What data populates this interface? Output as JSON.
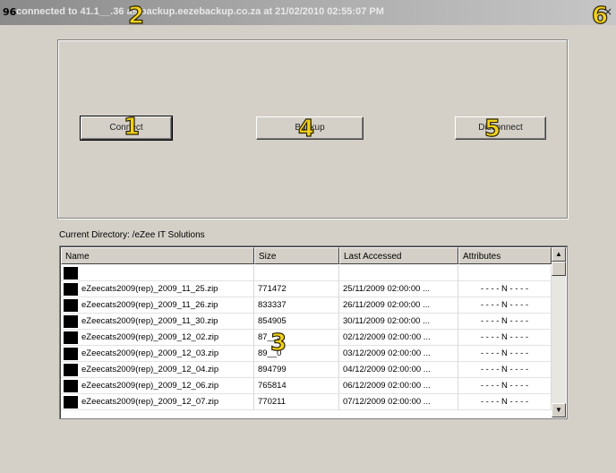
{
  "window": {
    "title": "connected to 41.1__.36 as backup.eezebackup.co.za at 21/02/2010 02:55:07 PM",
    "icon": "app-icon",
    "close_label": "×"
  },
  "buttons": {
    "connect": "Connect",
    "backup": "Backup",
    "disconnect": "Disconnect"
  },
  "current_directory": "Current Directory: /eZee  IT Solutions",
  "list": {
    "columns": [
      "Name",
      "Size",
      "Last Accessed",
      "Attributes"
    ],
    "rows": [
      {
        "name": "",
        "size": "",
        "accessed": "",
        "attrs": ""
      },
      {
        "name": "eZeecats2009(rep)_2009_11_25.zip",
        "size": "771472",
        "accessed": "25/11/2009 02:00:00 ...",
        "attrs": "- - - - N - - - -"
      },
      {
        "name": "eZeecats2009(rep)_2009_11_26.zip",
        "size": "833337",
        "accessed": "26/11/2009 02:00:00 ...",
        "attrs": "- - - - N - - - -"
      },
      {
        "name": "eZeecats2009(rep)_2009_11_30.zip",
        "size": "854905",
        "accessed": "30/11/2009 02:00:00 ...",
        "attrs": "- - - - N - - - -"
      },
      {
        "name": "eZeecats2009(rep)_2009_12_02.zip",
        "size": "87__3",
        "accessed": "02/12/2009 02:00:00 ...",
        "attrs": "- - - - N - - - -"
      },
      {
        "name": "eZeecats2009(rep)_2009_12_03.zip",
        "size": "89__0",
        "accessed": "03/12/2009 02:00:00 ...",
        "attrs": "- - - - N - - - -"
      },
      {
        "name": "eZeecats2009(rep)_2009_12_04.zip",
        "size": "894799",
        "accessed": "04/12/2009 02:00:00 ...",
        "attrs": "- - - - N - - - -"
      },
      {
        "name": "eZeecats2009(rep)_2009_12_06.zip",
        "size": "765814",
        "accessed": "06/12/2009 02:00:00 ...",
        "attrs": "- - - - N - - - -"
      },
      {
        "name": "eZeecats2009(rep)_2009_12_07.zip",
        "size": "770211",
        "accessed": "07/12/2009 02:00:00 ...",
        "attrs": "- - - - N - - - -"
      }
    ]
  },
  "markers": [
    "1",
    "2",
    "3",
    "4",
    "5",
    "6"
  ],
  "colors": {
    "marker": "#f2d21b",
    "window_bg": "#d4d0c8"
  }
}
